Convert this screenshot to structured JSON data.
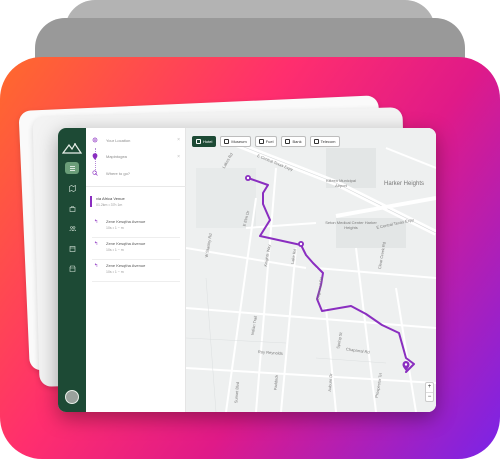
{
  "colors": {
    "sidebar": "#1d4a35",
    "route": "#8a2ec0",
    "chip_active": "#1d4a35"
  },
  "sidebar": {
    "logo": "mountain-logo-icon",
    "items": [
      {
        "icon": "list-icon",
        "active": true
      },
      {
        "icon": "map-icon",
        "active": false
      },
      {
        "icon": "bag-icon",
        "active": false
      },
      {
        "icon": "people-icon",
        "active": false
      },
      {
        "icon": "calendar-icon",
        "active": false
      },
      {
        "icon": "store-icon",
        "active": false
      }
    ]
  },
  "panel": {
    "stops": [
      {
        "label": "Your Location",
        "icon": "target-icon"
      },
      {
        "label": "Mapintogea",
        "icon": "pin-icon"
      },
      {
        "label": "Where to go?",
        "icon": "search-icon"
      }
    ],
    "route": {
      "title": "via Africa Venue",
      "subtitle": "01.2km • 37h 1m"
    },
    "steps": [
      {
        "name": "Zene Kesqtha Avenue",
        "detail": "10s • 1 ~ m"
      },
      {
        "name": "Zene Kesqtha Avenue",
        "detail": "10s • 1 ~ m"
      },
      {
        "name": "Zene Kesqtha Avenue",
        "detail": "10s • 1 ~ m"
      }
    ]
  },
  "map": {
    "chips": [
      {
        "label": "Hotel",
        "active": true
      },
      {
        "label": "Museum",
        "active": false
      },
      {
        "label": "Fuel",
        "active": false
      },
      {
        "label": "Bank",
        "active": false
      },
      {
        "label": "Telecom",
        "active": false
      }
    ],
    "labels": {
      "harker": "Harker Heights",
      "airport": "Killeen Municipal Airport",
      "medical": "Seton Medical Center Harker Heights",
      "hwy_top": "E Central Texas Expy",
      "hwy_right": "E Central Texas Expy",
      "fmroad": "W Stanley Rd",
      "road1": "Lakes Rd",
      "road2": "E Elm Dr",
      "road3": "Knights Way",
      "road4": "Lake Rd",
      "road5": "Chaparral Rd",
      "road6": "Clear Creek Rd",
      "road7": "Dogwood Rd",
      "road8": "Indian Trail",
      "road9": "Roy Reynolds",
      "road10": "Spring St",
      "road11": "Auburn Dr",
      "road12": "Paddock",
      "road13": "Sunset Blvd",
      "road14": "Prospector Trl"
    },
    "zoom": {
      "in": "+",
      "out": "−"
    }
  }
}
